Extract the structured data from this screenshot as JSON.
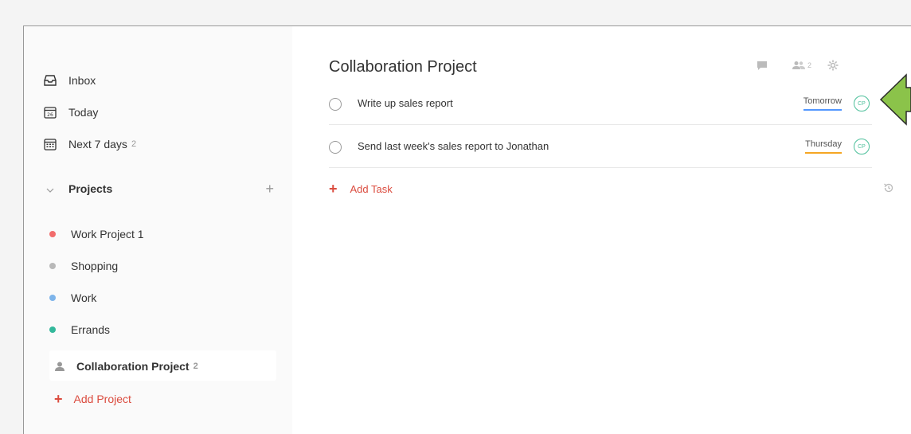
{
  "sidebar": {
    "inbox": "Inbox",
    "today": "Today",
    "today_day": "26",
    "next7": "Next 7 days",
    "next7_count": "2",
    "projects_label": "Projects",
    "projects": [
      {
        "name": "Work Project 1",
        "color": "#f26c6c"
      },
      {
        "name": "Shopping",
        "color": "#b8b8b8"
      },
      {
        "name": "Work",
        "color": "#7db4ea"
      },
      {
        "name": "Errands",
        "color": "#33b89b"
      }
    ],
    "active_project": "Collaboration Project",
    "active_project_count": "2",
    "add_project": "Add Project"
  },
  "main": {
    "title": "Collaboration Project",
    "share_count": "2",
    "tasks": [
      {
        "text": "Write up sales report",
        "date": "Tomorrow",
        "date_color": "#5297ff",
        "assignee": "CP"
      },
      {
        "text": "Send last week's sales report to Jonathan",
        "date": "Thursday",
        "date_color": "#f5a623",
        "assignee": "CP"
      }
    ],
    "add_task": "Add Task"
  },
  "colors": {
    "accent": "#db4c3f",
    "assignee": "#4cbf9a",
    "arrow": "#8bc34a"
  }
}
